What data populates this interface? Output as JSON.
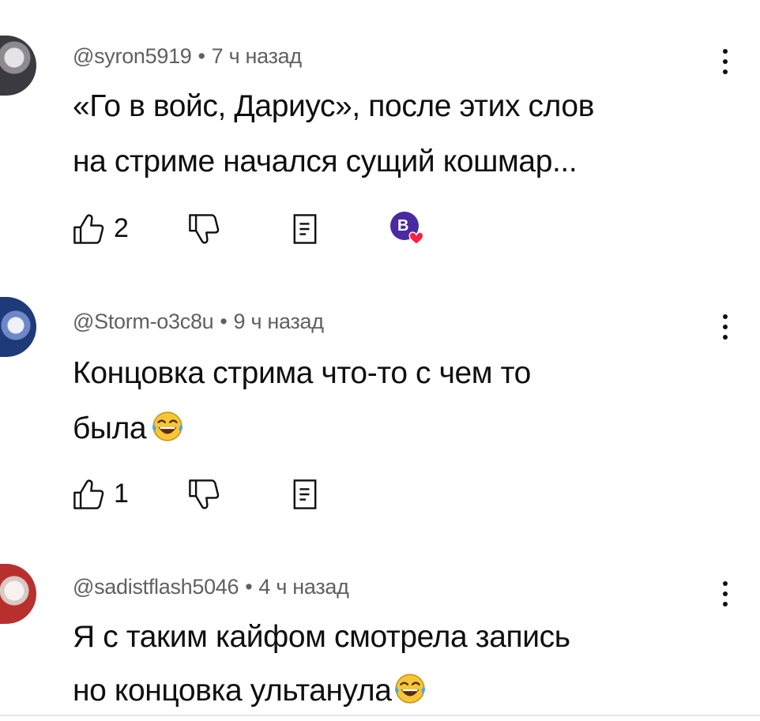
{
  "comments": [
    {
      "author": "@syron5919",
      "time": "7 ч назад",
      "lines": [
        "«Го в войс, Дариус», после этих слов",
        "на стриме начался сущий кошмар..."
      ],
      "likes": "2",
      "creator_heart": true,
      "avatar_colors": [
        "#c9c5c9",
        "#3a3a40"
      ]
    },
    {
      "author": "@Storm-o3c8u",
      "time": "9 ч назад",
      "lines": [
        "Концовка стрима что-то с чем то",
        "была"
      ],
      "likes": "1",
      "creator_heart": false,
      "avatar_colors": [
        "#1f3a78",
        "#d8dde8"
      ]
    },
    {
      "author": "@sadistflash5046",
      "time": "4 ч назад",
      "lines": [
        "Я с таким кайфом смотрела запись",
        "но концовка ультанула"
      ],
      "likes": "",
      "creator_heart": false,
      "avatar_colors": [
        "#f2ecea",
        "#b8302e"
      ]
    }
  ],
  "icons": {
    "like": "thumbs-up-icon",
    "dislike": "thumbs-down-icon",
    "reply": "reply-icon",
    "more": "kebab-menu-icon",
    "heart": "creator-heart-icon",
    "emoji": "tears-of-joy-emoji-icon"
  },
  "colors": {
    "meta_text": "#606060",
    "heart": "#ff1f44",
    "creator_badge": "#4a2aa0"
  }
}
